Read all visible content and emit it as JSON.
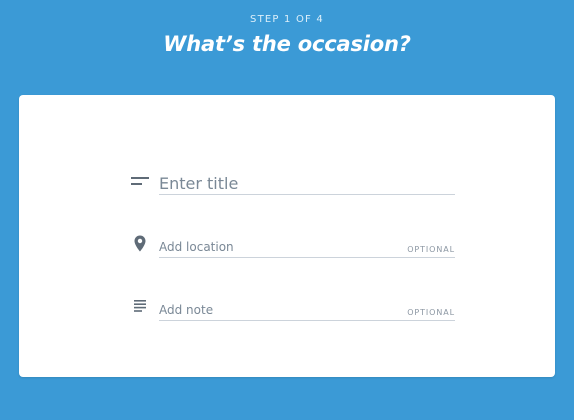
{
  "header": {
    "step": "STEP 1 OF 4",
    "title": "What’s the occasion?"
  },
  "form": {
    "title_field": {
      "placeholder": "Enter title",
      "icon": "short-text-icon"
    },
    "location_field": {
      "placeholder": "Add location",
      "hint": "OPTIONAL",
      "icon": "location-pin-icon"
    },
    "note_field": {
      "placeholder": "Add note",
      "hint": "OPTIONAL",
      "icon": "notes-icon"
    }
  },
  "colors": {
    "background": "#3B9AD6",
    "card": "#FFFFFF",
    "icon": "#5F6B77",
    "placeholder": "#7A8896",
    "underline": "#CCD3DB"
  }
}
